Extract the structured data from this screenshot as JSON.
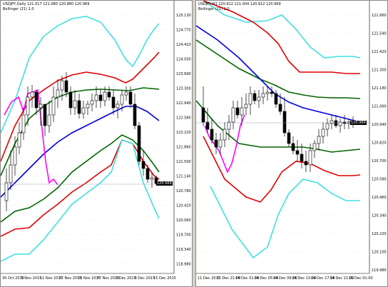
{
  "colors": {
    "background": "#ffffff",
    "grid": "#d8d8d8",
    "candle_up": "#ffffff",
    "candle_down": "#000000",
    "cyan_band": "#40e0e0",
    "red_band": "#e00000",
    "green_band": "#006400",
    "blue_ma": "#0000e0",
    "magenta_line": "#ff00ff",
    "current_price_line": "#a0a0c0"
  },
  "left_chart": {
    "title": "USDJPY,Daily  121.017 121.080 120.880 120.969",
    "indicator": "Bollinger (21) 1.0",
    "price_tag": "120.969",
    "y_ticks": [
      "125.130",
      "124.770",
      "124.410",
      "124.050",
      "123.690",
      "123.300",
      "122.940",
      "122.580",
      "122.220",
      "121.860",
      "121.500",
      "121.140",
      "120.780",
      "120.420",
      "120.060",
      "119.700",
      "119.340",
      "118.980"
    ],
    "x_ticks": [
      "30 Oct 2015",
      "5 Nov 2015",
      "11 Nov 2015",
      "17 Nov 2015",
      "23 Nov 2015",
      "27 Nov 2015",
      "3 Dec 2015",
      "9 Dec 2015",
      "15 Dec 2015"
    ]
  },
  "right_chart": {
    "title": "USDJPY,H1  120.912 121.004 120.912 120.969",
    "indicator": "Bollinger (21) 1.0",
    "price_tag": "120.969",
    "y_ticks": [
      "121.660",
      "121.540",
      "121.420",
      "121.300",
      "121.180",
      "121.060",
      "120.940",
      "120.820",
      "120.700",
      "120.580",
      "120.460",
      "120.340",
      "120.220",
      "120.100",
      "119.980"
    ],
    "x_ticks": [
      "11 Dec 2015",
      "11 Dec 21:00",
      "14 Dec 01:00",
      "14 Dec 05:00",
      "14 Dec 09:00",
      "14 Dec 13:00",
      "14 Dec 17:00",
      "14 Dec 21:00",
      "15 Dec 01:00"
    ]
  }
}
